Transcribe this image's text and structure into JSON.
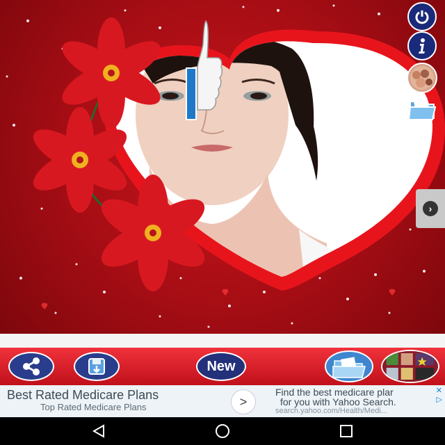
{
  "app": {
    "canvas_label": "",
    "next_icon": "chevron-right-icon"
  },
  "toolbar": {
    "new_label": "New",
    "icons": [
      "share-icon",
      "save-icon",
      "gallery-icon",
      "frames-icon"
    ]
  },
  "side_buttons": {
    "icons": [
      "power-icon",
      "info-icon",
      "collage-icon",
      "folder-icon"
    ]
  },
  "ad": {
    "title": "Best Rated Medicare Plans",
    "subtitle": "Top Rated Medicare Plans",
    "arrow": ">",
    "right_line1": "Find the best medicare plar",
    "right_line2": "for you with Yahoo Search.",
    "url": "search.yahoo.com/Health/Medi...",
    "close": "✕",
    "adchoices": "▷"
  },
  "navbar": {
    "icons": [
      "back-icon",
      "home-icon",
      "recents-icon"
    ]
  },
  "colors": {
    "background_red": "#a50d14",
    "heart_red": "#e8141c",
    "button_blue": "#2a3d8c",
    "toolbar_red": "#d81e28"
  }
}
